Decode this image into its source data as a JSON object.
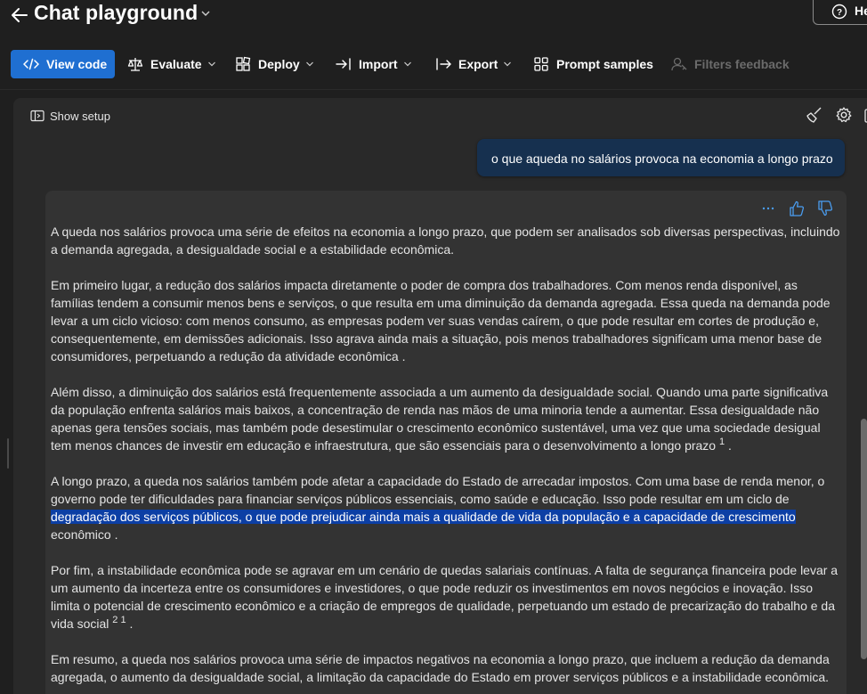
{
  "header": {
    "title": "Chat playground",
    "help_label": "He"
  },
  "toolbar": {
    "view_code": "View code",
    "evaluate": "Evaluate",
    "deploy": "Deploy",
    "import": "Import",
    "export": "Export",
    "prompt_samples": "Prompt samples",
    "filters_feedback": "Filters feedback"
  },
  "setup": {
    "show_setup": "Show setup"
  },
  "chat": {
    "user_message": "o que aqueda no salários provoca na economia a longo prazo",
    "response": {
      "p1": "A queda nos salários provoca uma série de efeitos na economia a longo prazo, que podem ser analisados sob diversas perspectivas, incluindo a demanda agregada, a desigualdade social e a estabilidade econômica.",
      "p2": "Em primeiro lugar, a redução dos salários impacta diretamente o poder de compra dos trabalhadores. Com menos renda disponível, as famílias tendem a consumir menos bens e serviços, o que resulta em uma diminuição da demanda agregada. Essa queda na demanda pode levar a um ciclo vicioso: com menos consumo, as empresas podem ver suas vendas caírem, o que pode resultar em cortes de produção e, consequentemente, em demissões adicionais. Isso agrava ainda mais a situação, pois menos trabalhadores significam uma menor base de consumidores, perpetuando a redução da atividade econômica .",
      "p3": "Além disso, a diminuição dos salários está frequentemente associada a um aumento da desigualdade social. Quando uma parte significativa da população enfrenta salários mais baixos, a concentração de renda nas mãos de uma minoria tende a aumentar. Essa desigualdade não apenas gera tensões sociais, mas também pode desestimular o crescimento econômico sustentável, uma vez que uma sociedade desigual tem menos chances de investir em educação e infraestrutura, que são essenciais para o desenvolvimento a longo prazo",
      "p3_ref": "1",
      "p3_end": ".",
      "p4_a": "A longo prazo, a queda nos salários também pode afetar a capacidade do Estado de arrecadar impostos. Com uma base de renda menor, o governo pode ter dificuldades para financiar serviços públicos essenciais, como saúde e educação. Isso pode resultar em um ciclo de",
      "p4_highlight": "degradação dos serviços públicos, o que pode prejudicar ainda mais a qualidade de vida da população e a capacidade de crescimento",
      "p4_b": "econômico .",
      "p5": "Por fim, a instabilidade econômica pode se agravar em um cenário de quedas salariais contínuas. A falta de segurança financeira pode levar a um aumento da incerteza entre os consumidores e investidores, o que pode reduzir os investimentos em novos negócios e inovação. Isso limita o potencial de crescimento econômico e a criação de empregos de qualidade, perpetuando um estado de precarização do trabalho e da vida social",
      "p5_ref": "2 1",
      "p5_end": ".",
      "p6": "Em resumo, a queda nos salários provoca uma série de impactos negativos na economia a longo prazo, que incluem a redução da demanda agregada, o aumento da desigualdade social, a limitação da capacidade do Estado em prover serviços públicos e a instabilidade econômica."
    }
  },
  "colors": {
    "primary": "#1f6fd1",
    "user_bubble": "#16304f",
    "highlight": "#0c3fa5"
  }
}
